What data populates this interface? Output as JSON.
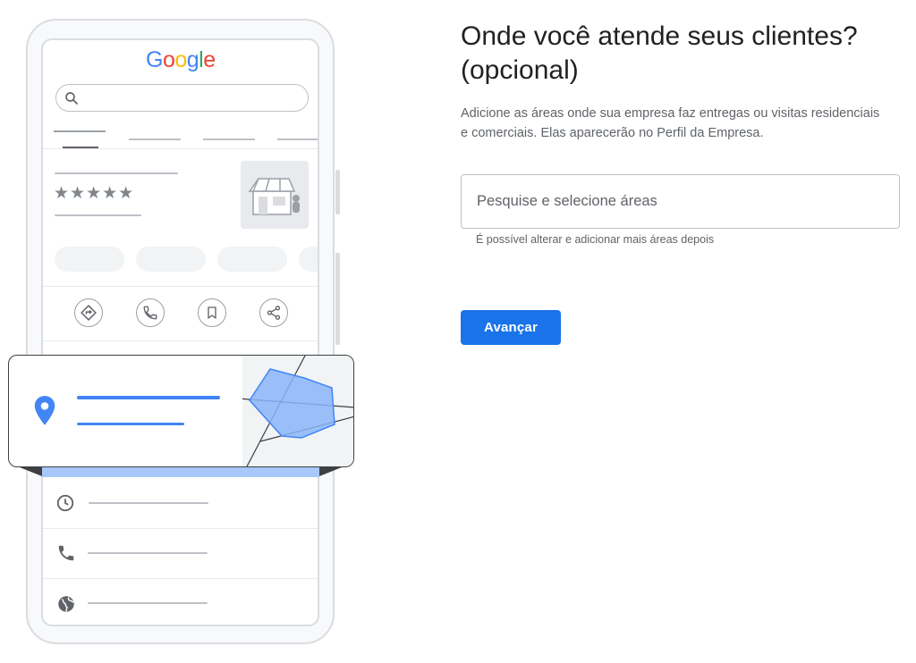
{
  "illustration": {
    "logo": {
      "letters": [
        "G",
        "o",
        "o",
        "g",
        "l",
        "e"
      ],
      "colors": [
        "#4285f4",
        "#ea4335",
        "#fbbc05",
        "#4285f4",
        "#34a853",
        "#ea4335"
      ]
    },
    "rating_stars": "★★★★★",
    "icons": {
      "search": "search-icon",
      "directions": "directions-icon",
      "call": "phone-icon",
      "save": "bookmark-icon",
      "share": "share-icon",
      "location": "location-pin-icon",
      "hours": "clock-icon",
      "phone": "phone-icon",
      "website": "globe-icon"
    },
    "colors": {
      "pin": "#4285f4",
      "area_fill": "#8ab4f8",
      "area_stroke": "#4285f4",
      "map_bg": "#f1f3f4"
    }
  },
  "panel": {
    "heading": "Onde você atende seus clientes? (opcional)",
    "description": "Adicione as áreas onde sua empresa faz entregas ou visitas residenciais e comerciais. Elas aparecerão no Perfil da Empresa.",
    "search": {
      "placeholder": "Pesquise e selecione áreas",
      "value": ""
    },
    "helper": "É possível alterar e adicionar mais áreas depois",
    "advance_label": "Avançar",
    "accent_color": "#1a73e8"
  }
}
